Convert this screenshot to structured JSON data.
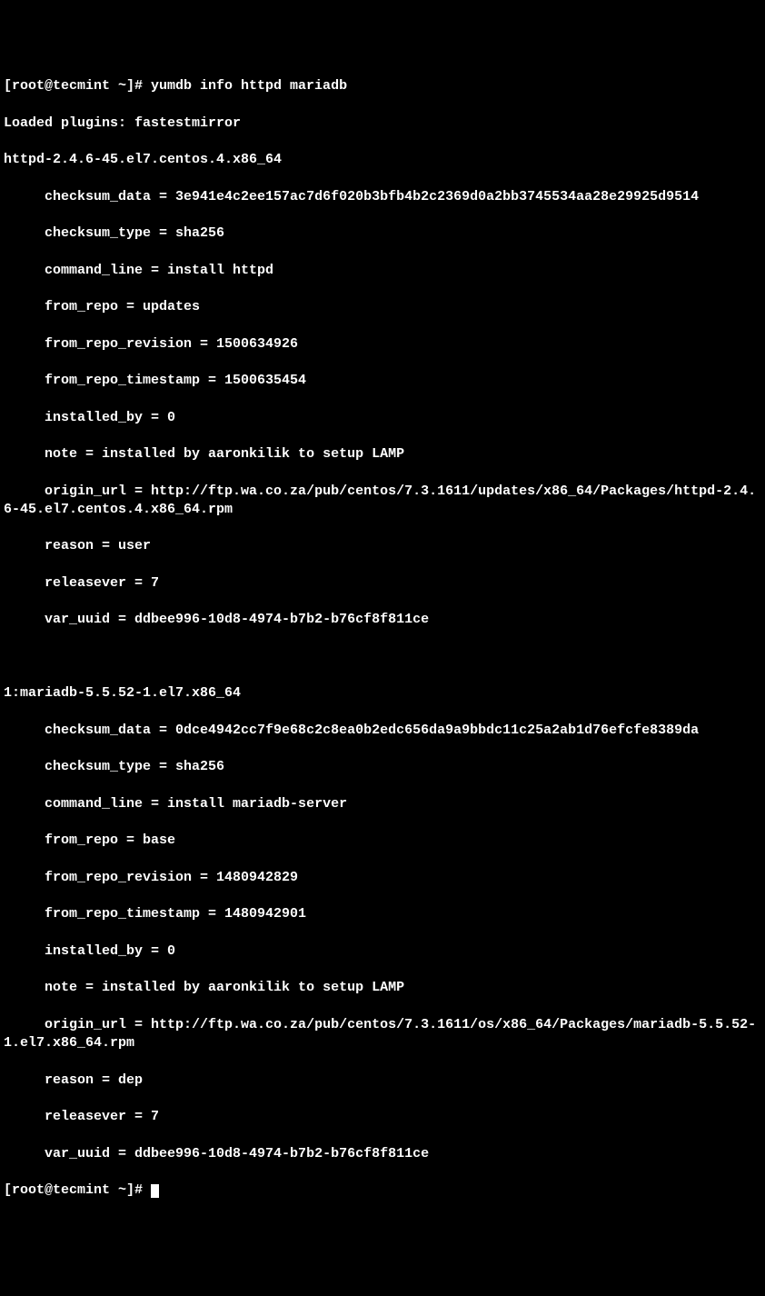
{
  "prompt1": "[root@tecmint ~]# ",
  "command1": "yumdb info httpd mariadb",
  "loaded_plugins": "Loaded plugins: fastestmirror",
  "pkg1_header": "httpd-2.4.6-45.el7.centos.4.x86_64",
  "pkg1": {
    "checksum_data": "     checksum_data = 3e941e4c2ee157ac7d6f020b3bfb4b2c2369d0a2bb3745534aa28e29925d9514",
    "checksum_type": "     checksum_type = sha256",
    "command_line": "     command_line = install httpd",
    "from_repo": "     from_repo = updates",
    "from_repo_revision": "     from_repo_revision = 1500634926",
    "from_repo_timestamp": "     from_repo_timestamp = 1500635454",
    "installed_by": "     installed_by = 0",
    "note": "     note = installed by aaronkilik to setup LAMP",
    "origin_url": "     origin_url = http://ftp.wa.co.za/pub/centos/7.3.1611/updates/x86_64/Packages/httpd-2.4.6-45.el7.centos.4.x86_64.rpm",
    "reason": "     reason = user",
    "releasever": "     releasever = 7",
    "var_uuid": "     var_uuid = ddbee996-10d8-4974-b7b2-b76cf8f811ce"
  },
  "pkg2_header": "1:mariadb-5.5.52-1.el7.x86_64",
  "pkg2": {
    "checksum_data": "     checksum_data = 0dce4942cc7f9e68c2c8ea0b2edc656da9a9bbdc11c25a2ab1d76efcfe8389da",
    "checksum_type": "     checksum_type = sha256",
    "command_line": "     command_line = install mariadb-server",
    "from_repo": "     from_repo = base",
    "from_repo_revision": "     from_repo_revision = 1480942829",
    "from_repo_timestamp": "     from_repo_timestamp = 1480942901",
    "installed_by": "     installed_by = 0",
    "note": "     note = installed by aaronkilik to setup LAMP",
    "origin_url": "     origin_url = http://ftp.wa.co.za/pub/centos/7.3.1611/os/x86_64/Packages/mariadb-5.5.52-1.el7.x86_64.rpm",
    "reason": "     reason = dep",
    "releasever": "     releasever = 7",
    "var_uuid": "     var_uuid = ddbee996-10d8-4974-b7b2-b76cf8f811ce"
  },
  "prompt2": "[root@tecmint ~]# "
}
